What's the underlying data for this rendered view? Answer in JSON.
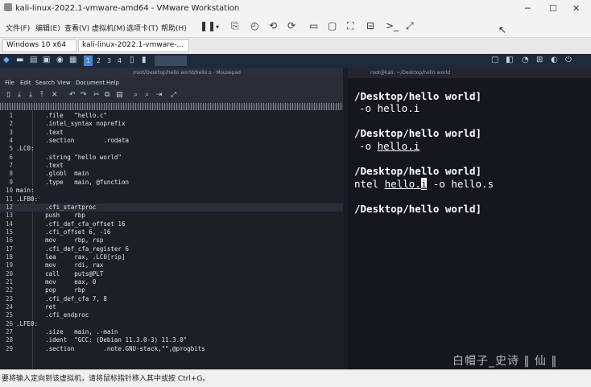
{
  "vmware": {
    "window_title": "kali-linux-2022.1-vmware-amd64 - VMware Workstation",
    "menu": [
      "文件(F)",
      "编辑(E)",
      "查看(V)",
      "虚拟机(M)",
      "选项卡(T)",
      "帮助(H)"
    ],
    "tabs": [
      "Windows 10 x64",
      "kali-linux-2022.1-vmware-..."
    ],
    "status_text": "要将输入定向到该虚拟机，请将鼠标指针移入其中或按 Ctrl+G。"
  },
  "kali_panel": {
    "workspaces": [
      "1",
      "2",
      "3",
      "4"
    ]
  },
  "mousepad": {
    "title": "/root/Desktop/hello world/hello.s - Mousepad",
    "menu": [
      "File",
      "Edit",
      "Search",
      "View",
      "Document",
      "Help"
    ],
    "lines": [
      {
        "n": "1",
        "text": "        .file   \"hello.c\""
      },
      {
        "n": "2",
        "text": "        .intel_syntax noprefix"
      },
      {
        "n": "3",
        "text": "        .text"
      },
      {
        "n": "4",
        "text": "        .section        .rodata"
      },
      {
        "n": "5",
        "text": ".LC0:"
      },
      {
        "n": "6",
        "text": "        .string \"hello world\""
      },
      {
        "n": "7",
        "text": "        .text"
      },
      {
        "n": "8",
        "text": "        .globl  main"
      },
      {
        "n": "9",
        "text": "        .type   main, @function"
      },
      {
        "n": "10",
        "text": "main:"
      },
      {
        "n": "11",
        "text": ".LFB0:"
      },
      {
        "n": "12",
        "text": "        .cfi_startproc"
      },
      {
        "n": "13",
        "text": "        push    rbp"
      },
      {
        "n": "14",
        "text": "        .cfi_def_cfa_offset 16"
      },
      {
        "n": "15",
        "text": "        .cfi_offset 6, -16"
      },
      {
        "n": "16",
        "text": "        mov     rbp, rsp"
      },
      {
        "n": "17",
        "text": "        .cfi_def_cfa_register 6"
      },
      {
        "n": "18",
        "text": "        lea     rax, .LC0[rip]"
      },
      {
        "n": "19",
        "text": "        mov     rdi, rax"
      },
      {
        "n": "20",
        "text": "        call    puts@PLT"
      },
      {
        "n": "21",
        "text": "        mov     eax, 0"
      },
      {
        "n": "22",
        "text": "        pop     rbp"
      },
      {
        "n": "23",
        "text": "        .cfi_def_cfa 7, 8"
      },
      {
        "n": "24",
        "text": "        ret"
      },
      {
        "n": "25",
        "text": "        .cfi_endproc"
      },
      {
        "n": "26",
        "text": ".LFE0:"
      },
      {
        "n": "27",
        "text": "        .size   main, .-main"
      },
      {
        "n": "28",
        "text": "        .ident  \"GCC: (Debian 11.3.0-3) 11.3.0\""
      },
      {
        "n": "29",
        "text": "        .section        .note.GNU-stack,\"\",@progbits"
      }
    ],
    "active_line": "12"
  },
  "terminal": {
    "title": "root@kali: ~/Desktop/hello world",
    "prompt_1": "/Desktop/hello world]",
    "cmd_1": "-o hello.i",
    "prompt_2": "/Desktop/hello world]",
    "cmd_2_prefix": "-o ",
    "cmd_2_file": "hello.i",
    "prompt_3": "/Desktop/hello world]",
    "cmd_3_prefix": "ntel ",
    "cmd_3_file": "hello.",
    "cmd_3_cursor": "i",
    "cmd_3_suffix": " -o hello.s",
    "prompt_4": "/Desktop/hello world]"
  },
  "watermark": "白帽子_史诗 ‖ 仙 ‖"
}
